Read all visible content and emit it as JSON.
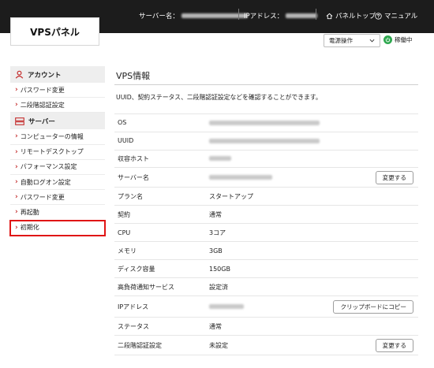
{
  "header": {
    "logo": "VPSパネル",
    "server_name_label": "サーバー名：",
    "ip_label": "IPアドレス：",
    "panel_top": "パネルトップ",
    "manual": "マニュアル"
  },
  "controls": {
    "power_select": "電源操作",
    "status": "稼働中",
    "status_color": "#2fa84f"
  },
  "sidebar": {
    "account_heading": "アカウント",
    "account_items": [
      "パスワード変更",
      "二段階認証設定"
    ],
    "server_heading": "サーバー",
    "server_items": [
      "コンピューターの情報",
      "リモートデスクトップ",
      "パフォーマンス設定",
      "自動ログオン設定",
      "パスワード変更",
      "再起動",
      "初期化"
    ],
    "highlight_color": "#e01515"
  },
  "main": {
    "title": "VPS情報",
    "description": "UUID、契約ステータス、二段階認証設定などを確認することができます。",
    "rows": [
      {
        "label": "OS",
        "value": ""
      },
      {
        "label": "UUID",
        "value": ""
      },
      {
        "label": "収容ホスト",
        "value": ""
      },
      {
        "label": "サーバー名",
        "value": "",
        "button": "変更する"
      },
      {
        "label": "プラン名",
        "value": "スタートアップ"
      },
      {
        "label": "契約",
        "value": "通常"
      },
      {
        "label": "CPU",
        "value": "3コア"
      },
      {
        "label": "メモリ",
        "value": "3GB"
      },
      {
        "label": "ディスク容量",
        "value": "150GB"
      },
      {
        "label": "高負荷通知サービス",
        "value": "設定済"
      },
      {
        "label": "IPアドレス",
        "value": "",
        "button": "クリップボードにコピー"
      },
      {
        "label": "ステータス",
        "value": "通常"
      },
      {
        "label": "二段階認証設定",
        "value": "未設定",
        "button": "変更する"
      }
    ]
  }
}
